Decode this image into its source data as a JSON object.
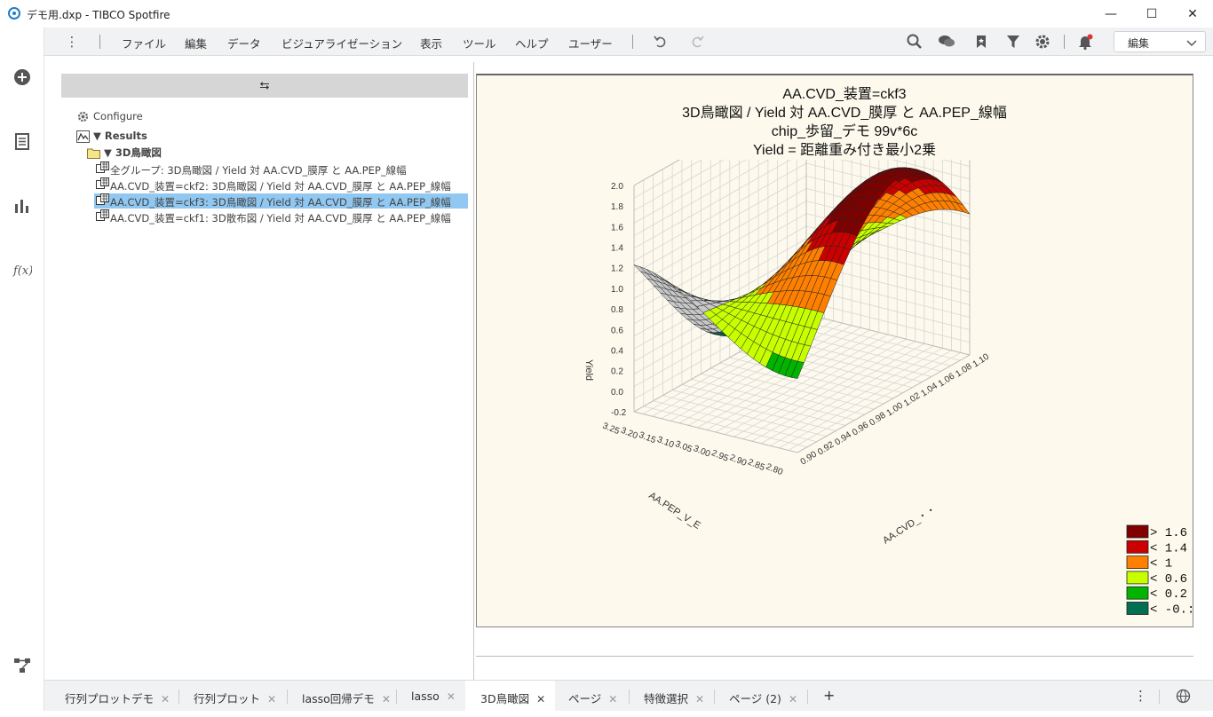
{
  "window": {
    "title": "デモ用.dxp - TIBCO Spotfire",
    "minimize_glyph": "—",
    "maximize_glyph": "☐",
    "close_glyph": "✕"
  },
  "menu": {
    "items": [
      "ファイル",
      "編集",
      "データ",
      "ビジュアライゼーション",
      "表示",
      "ツール",
      "ヘルプ",
      "ユーザー"
    ],
    "edit_mode": "編集"
  },
  "left_panel": {
    "collapse_glyph": "⮀",
    "configure_label": "Configure",
    "results_label": "▼ Results",
    "folder_label": "▼ 3D鳥瞰図",
    "rows": [
      "全グループ: 3D鳥瞰図 / Yield 対 AA.CVD_膜厚 と AA.PEP_線幅",
      "AA.CVD_装置=ckf2: 3D鳥瞰図 / Yield 対 AA.CVD_膜厚 と AA.PEP_線幅",
      "AA.CVD_装置=ckf3: 3D鳥瞰図 / Yield 対 AA.CVD_膜厚 と AA.PEP_線幅",
      "AA.CVD_装置=ckf1: 3D散布図 / Yield 対 AA.CVD_膜厚 と AA.PEP_線幅"
    ],
    "selected_index": 2
  },
  "chart": {
    "title_lines": [
      "AA.CVD_装置=ckf3",
      "3D鳥瞰図 / Yield 対 AA.CVD_膜厚 と AA.PEP_線幅",
      "chip_歩留_デモ 99v*6c",
      "Yield = 距離重み付き最小2乗"
    ]
  },
  "chart_data": {
    "type": "surface",
    "title": "AA.CVD_装置=ckf3 / 3D鳥瞰図 / Yield 対 AA.CVD_膜厚 と AA.PEP_線幅 / chip_歩留_デモ 99v*6c / Yield = 距離重み付き最小2乗",
    "zlabel": "Yield",
    "xlabel": "AA.CVD_・・",
    "ylabel": "AA.PEP_V_E",
    "z_ticks": [
      "2.0",
      "1.8",
      "1.6",
      "1.4",
      "1.2",
      "1.0",
      "0.8",
      "0.6",
      "0.4",
      "0.2",
      "0.0",
      "-0.2"
    ],
    "x_ticks": [
      "0.90",
      "0.92",
      "0.94",
      "0.96",
      "0.98",
      "1.00",
      "1.02",
      "1.04",
      "1.06",
      "1.08",
      "1.10"
    ],
    "y_ticks": [
      "2.80",
      "2.85",
      "2.90",
      "2.95",
      "3.00",
      "3.05",
      "3.10",
      "3.15",
      "3.20",
      "3.25"
    ],
    "zlim": [
      -0.2,
      2.0
    ],
    "xlim": [
      0.9,
      1.1
    ],
    "ylim": [
      2.8,
      3.25
    ],
    "legend": [
      {
        "label": ">  1.6",
        "color": "#800000"
      },
      {
        "label": "<  1.4",
        "color": "#cc0000"
      },
      {
        "label": "<   1",
        "color": "#ff8000"
      },
      {
        "label": "<  0.6",
        "color": "#c8ff00"
      },
      {
        "label": "<  0.2",
        "color": "#00b400"
      },
      {
        "label": "<  -0.:",
        "color": "#007050"
      }
    ],
    "legend_placement": "bottom-right"
  },
  "tabs": {
    "items": [
      "行列プロットデモ",
      "行列プロット",
      "lasso回帰デモ",
      "lasso",
      "3D鳥瞰図",
      "ページ",
      "特徴選択",
      "ページ (2)"
    ],
    "active_index": 4,
    "add_glyph": "+"
  }
}
